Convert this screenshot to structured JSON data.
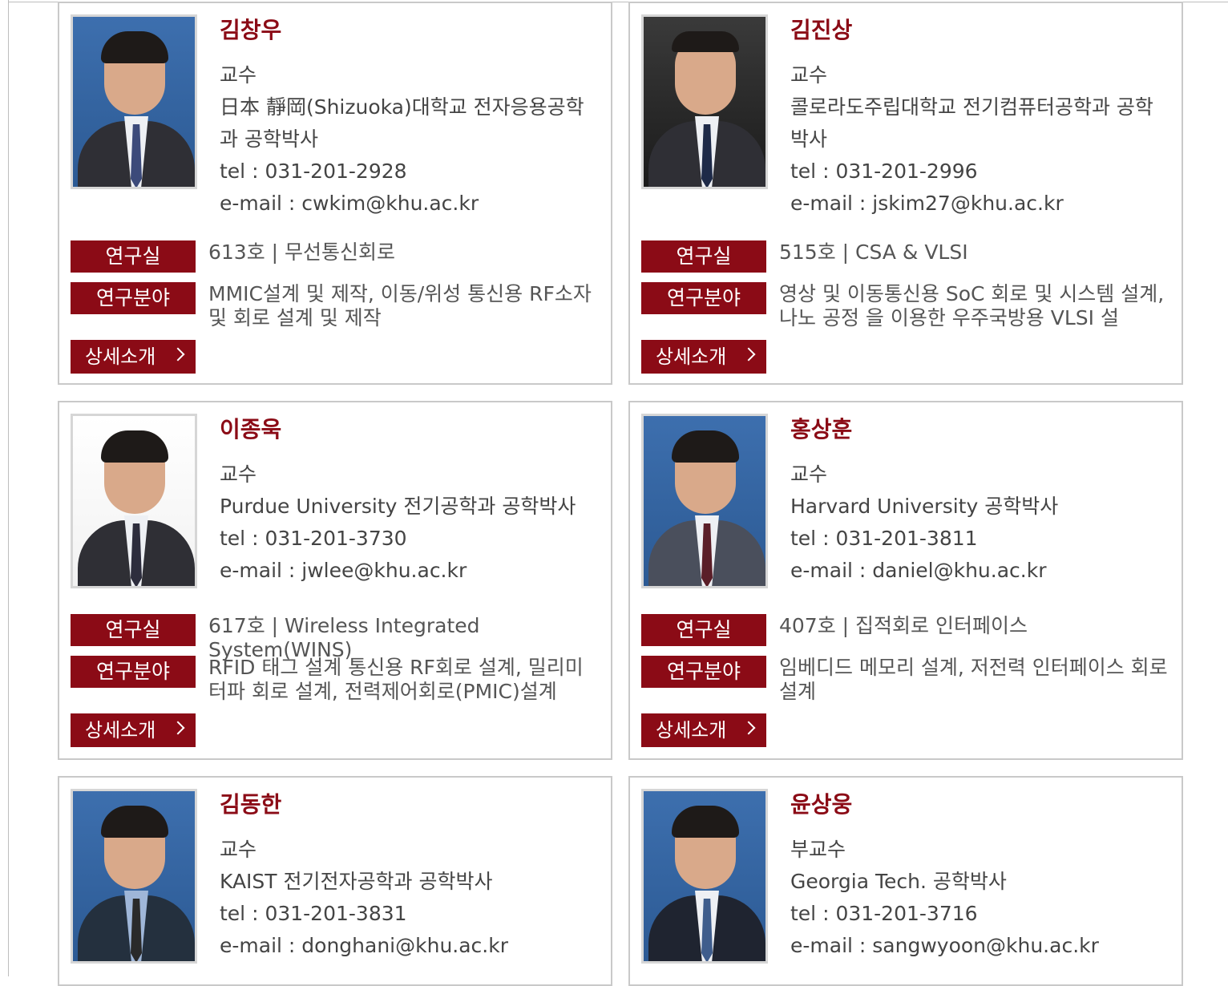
{
  "labels": {
    "lab": "연구실",
    "field": "연구분야",
    "detail": "상세소개"
  },
  "professors": [
    {
      "name": "김창우",
      "position": "교수",
      "degree": "日本 靜岡(Shizuoka)대학교 전자응용공학과 공학박사",
      "tel": "tel : 031-201-2928",
      "email": "e-mail : cwkim@khu.ac.kr",
      "lab": "613호 | 무선통신회로",
      "field": "MMIC설계 및 제작, 이동/위성 통신용 RF소자 및 회로 설계 및 제작"
    },
    {
      "name": "김진상",
      "position": "교수",
      "degree": "콜로라도주립대학교 전기컴퓨터공학과 공학박사",
      "tel": "tel : 031-201-2996",
      "email": "e-mail : jskim27@khu.ac.kr",
      "lab": "515호 | CSA & VLSI",
      "field": "영상 및 이동통신용 SoC 회로 및 시스템 설계, 나노 공정 을 이용한 우주국방용 VLSI 설"
    },
    {
      "name": "이종욱",
      "position": "교수",
      "degree": "Purdue University 전기공학과 공학박사",
      "tel": "tel : 031-201-3730",
      "email": "e-mail : jwlee@khu.ac.kr",
      "lab": "617호 | Wireless Integrated System(WINS)",
      "field": "RFID 태그 설계 통신용 RF회로 설계, 밀리미터파 회로 설계, 전력제어회로(PMIC)설계"
    },
    {
      "name": "홍상훈",
      "position": "교수",
      "degree": "Harvard University 공학박사",
      "tel": "tel : 031-201-3811",
      "email": "e-mail : daniel@khu.ac.kr",
      "lab": "407호 | 집적회로 인터페이스",
      "field": "임베디드 메모리 설계, 저전력 인터페이스 회로설계"
    },
    {
      "name": "김동한",
      "position": "교수",
      "degree": "KAIST 전기전자공학과 공학박사",
      "tel": "tel : 031-201-3831",
      "email": "e-mail : donghani@khu.ac.kr"
    },
    {
      "name": "윤상웅",
      "position": "부교수",
      "degree": "Georgia Tech. 공학박사",
      "tel": "tel : 031-201-3716",
      "email": "e-mail : sangwyoon@khu.ac.kr"
    }
  ]
}
